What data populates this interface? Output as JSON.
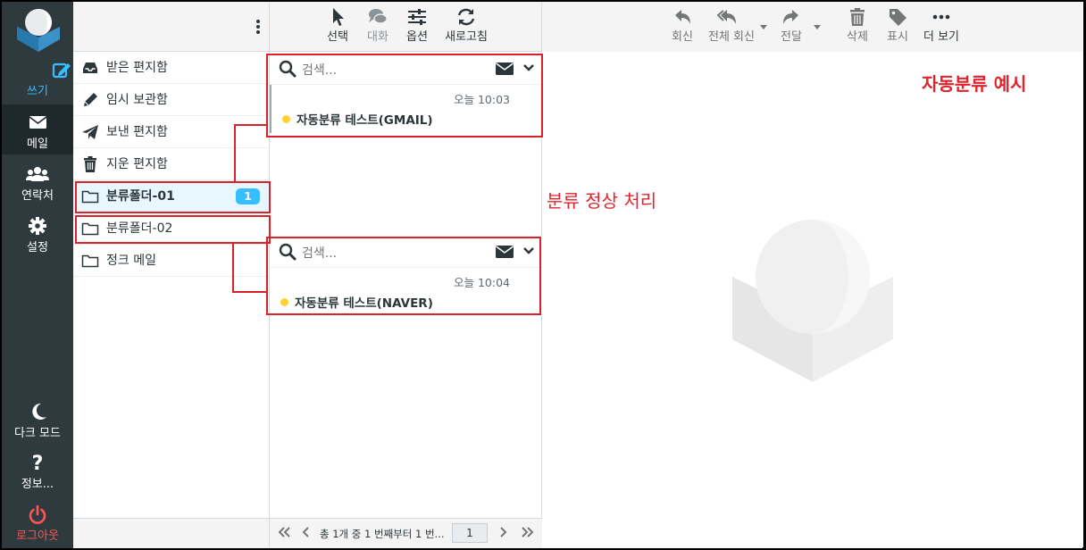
{
  "nav": {
    "compose": "쓰기",
    "mail": "메일",
    "contacts": "연락처",
    "settings": "설정",
    "dark_mode": "다크 모드",
    "about": "정보...",
    "logout": "로그아웃"
  },
  "list_toolbar": {
    "select": "선택",
    "threads": "대화",
    "options": "옵션",
    "refresh": "새로고침"
  },
  "folders": [
    {
      "label": "받은 편지함",
      "icon": "inbox-icon"
    },
    {
      "label": "임시 보관함",
      "icon": "pencil-icon"
    },
    {
      "label": "보낸 편지함",
      "icon": "paper-plane-icon"
    },
    {
      "label": "지운 편지함",
      "icon": "trash-icon"
    },
    {
      "label": "분류폴더-01",
      "icon": "folder-icon",
      "unread": "1",
      "selected": true
    },
    {
      "label": "분류폴더-02",
      "icon": "folder-icon"
    },
    {
      "label": "정크 메일",
      "icon": "folder-icon"
    }
  ],
  "search": {
    "placeholder": "검색..."
  },
  "messages": [
    {
      "time": "오늘 10:03",
      "subject": "자동분류 테스트(GMAIL)"
    },
    {
      "time": "오늘 10:04",
      "subject": "자동분류 테스트(NAVER)"
    }
  ],
  "pager": {
    "text": "총 1개 중 1 번째부터 1 번...",
    "page": "1"
  },
  "message_toolbar": {
    "reply": "회신",
    "reply_all": "전체 회신",
    "forward": "전달",
    "delete": "삭제",
    "mark": "표시",
    "more": "더 보기"
  },
  "annotations": {
    "example_title": "자동분류 예시",
    "classified_ok": "분류 정상 처리"
  },
  "colors": {
    "accent": "#37beff",
    "nav_bg": "#2f3a3f",
    "annotation_red": "#d8222c",
    "unread_dot": "#ffd233"
  }
}
